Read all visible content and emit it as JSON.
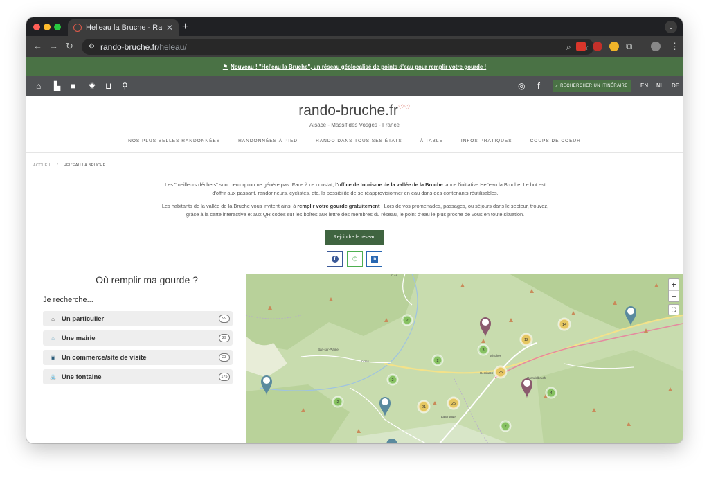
{
  "browser": {
    "tab_title": "Hel'eau la Bruche - Rando Br",
    "url_host": "rando-bruche.fr",
    "url_path": "/heleau/"
  },
  "announcement": {
    "flag": "⚑",
    "text": "Nouveau ! \"Hel'eau la Bruche\", un réseau géolocalisé de points d'eau pour remplir votre gourde !"
  },
  "sitenav": {
    "icons": [
      "home-icon",
      "boot-icon",
      "video-icon",
      "settings-icon",
      "basket-icon",
      "bike-icon"
    ],
    "route_button": "RECHERCHER UN ITINÉRAIRE",
    "languages": [
      "EN",
      "NL",
      "DE"
    ]
  },
  "header": {
    "logo": "rando-bruche.fr",
    "tagline": "Alsace - Massif des Vosges - France",
    "menu": [
      "NOS PLUS BELLES RANDONNÉES",
      "RANDONNÉES À PIED",
      "RANDO DANS TOUS SES ÉTATS",
      "À TABLE",
      "INFOS PRATIQUES",
      "COUPS DE COEUR"
    ]
  },
  "breadcrumb": {
    "home": "ACCUEIL",
    "current": "HEL'EAU LA BRUCHE"
  },
  "intro": {
    "p1_a": "Les \"meilleurs déchets\" sont ceux qu'on ne génère pas. Face à ce constat, ",
    "p1_b": "l'office de tourisme de la vallée de la Bruche",
    "p1_c": " lance l'initiative Hel'eau la Bruche. Le but est d'offrir aux passant, randonneurs, cyclistes, etc. la possibilité de se réapprovisionner en eau dans des contenants réutilisables.",
    "p2_a": "Les habitants de la vallée de la Bruche vous invitent ainsi à ",
    "p2_b": "remplir votre gourde gratuitement",
    "p2_c": " ! Lors de vos promenades, passages, ou séjours dans le secteur, trouvez, grâce à la carte interactive et aux QR codes sur les boîtes aux lettre des membres du réseau, le point d'eau le plus proche de vous en toute situation."
  },
  "join_button": "Rejoindre le réseau",
  "share": {
    "facebook": "f",
    "whatsapp": "✆",
    "linkedin": "in"
  },
  "panel": {
    "title": "Où remplir ma gourde ?",
    "search_label": "Je recherche...",
    "filters": [
      {
        "label": "Un particulier",
        "count": "99",
        "icon": "house-icon"
      },
      {
        "label": "Une mairie",
        "count": "29",
        "icon": "town-hall-icon"
      },
      {
        "label": "Un commerce/site de visite",
        "count": "23",
        "icon": "shop-icon"
      },
      {
        "label": "Une fontaine",
        "count": "175",
        "icon": "fountain-icon"
      }
    ]
  },
  "map": {
    "road_labels": [
      "D 44",
      "D 392"
    ],
    "places": [
      "Ban-sur-Plaine",
      "Wisches",
      "Hersbach",
      "Grendelbruch",
      "La Broque"
    ],
    "clusters": [
      {
        "count": "2",
        "color": "#7fbf5a"
      },
      {
        "count": "14",
        "color": "#e8c45a"
      },
      {
        "count": "12",
        "color": "#e8c45a"
      },
      {
        "count": "3",
        "color": "#7fbf5a"
      },
      {
        "count": "2",
        "color": "#7fbf5a"
      },
      {
        "count": "25",
        "color": "#e8c45a"
      },
      {
        "count": "2",
        "color": "#7fbf5a"
      },
      {
        "count": "4",
        "color": "#7fbf5a"
      },
      {
        "count": "2",
        "color": "#7fbf5a"
      },
      {
        "count": "21",
        "color": "#e8c45a"
      },
      {
        "count": "25",
        "color": "#e8c45a"
      },
      {
        "count": "2",
        "color": "#7fbf5a"
      }
    ],
    "zoom_in": "+",
    "zoom_out": "−",
    "fullscreen": "⛶"
  },
  "colors": {
    "accent_green": "#4a7245",
    "nav_gray": "#4f5154",
    "pin_blue": "#5a8a9e",
    "pin_purple": "#8a5a6e"
  }
}
